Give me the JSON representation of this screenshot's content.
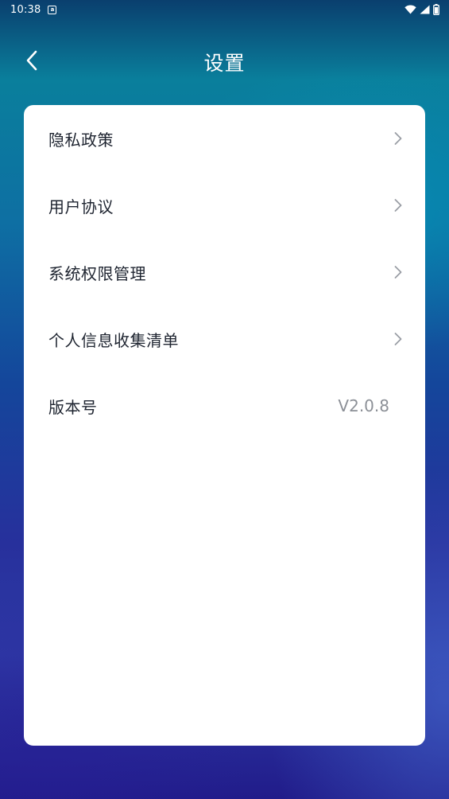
{
  "status_bar": {
    "time": "10:38",
    "notification_icon": "a",
    "icons": [
      "wifi-icon",
      "signal-icon",
      "battery-icon"
    ]
  },
  "header": {
    "title": "设置",
    "back_icon": "chevron-left-icon"
  },
  "settings": {
    "items": [
      {
        "label": "隐私政策",
        "icon": "chevron-right-icon"
      },
      {
        "label": "用户协议",
        "icon": "chevron-right-icon"
      },
      {
        "label": "系统权限管理",
        "icon": "chevron-right-icon"
      },
      {
        "label": "个人信息收集清单",
        "icon": "chevron-right-icon"
      }
    ],
    "version": {
      "label": "版本号",
      "value": "V2.0.8"
    }
  },
  "colors": {
    "text_primary": "#1e2430",
    "text_secondary": "#8c9097",
    "chevron": "#9a9ea5",
    "card": "#ffffff",
    "header_text": "#ffffff"
  }
}
